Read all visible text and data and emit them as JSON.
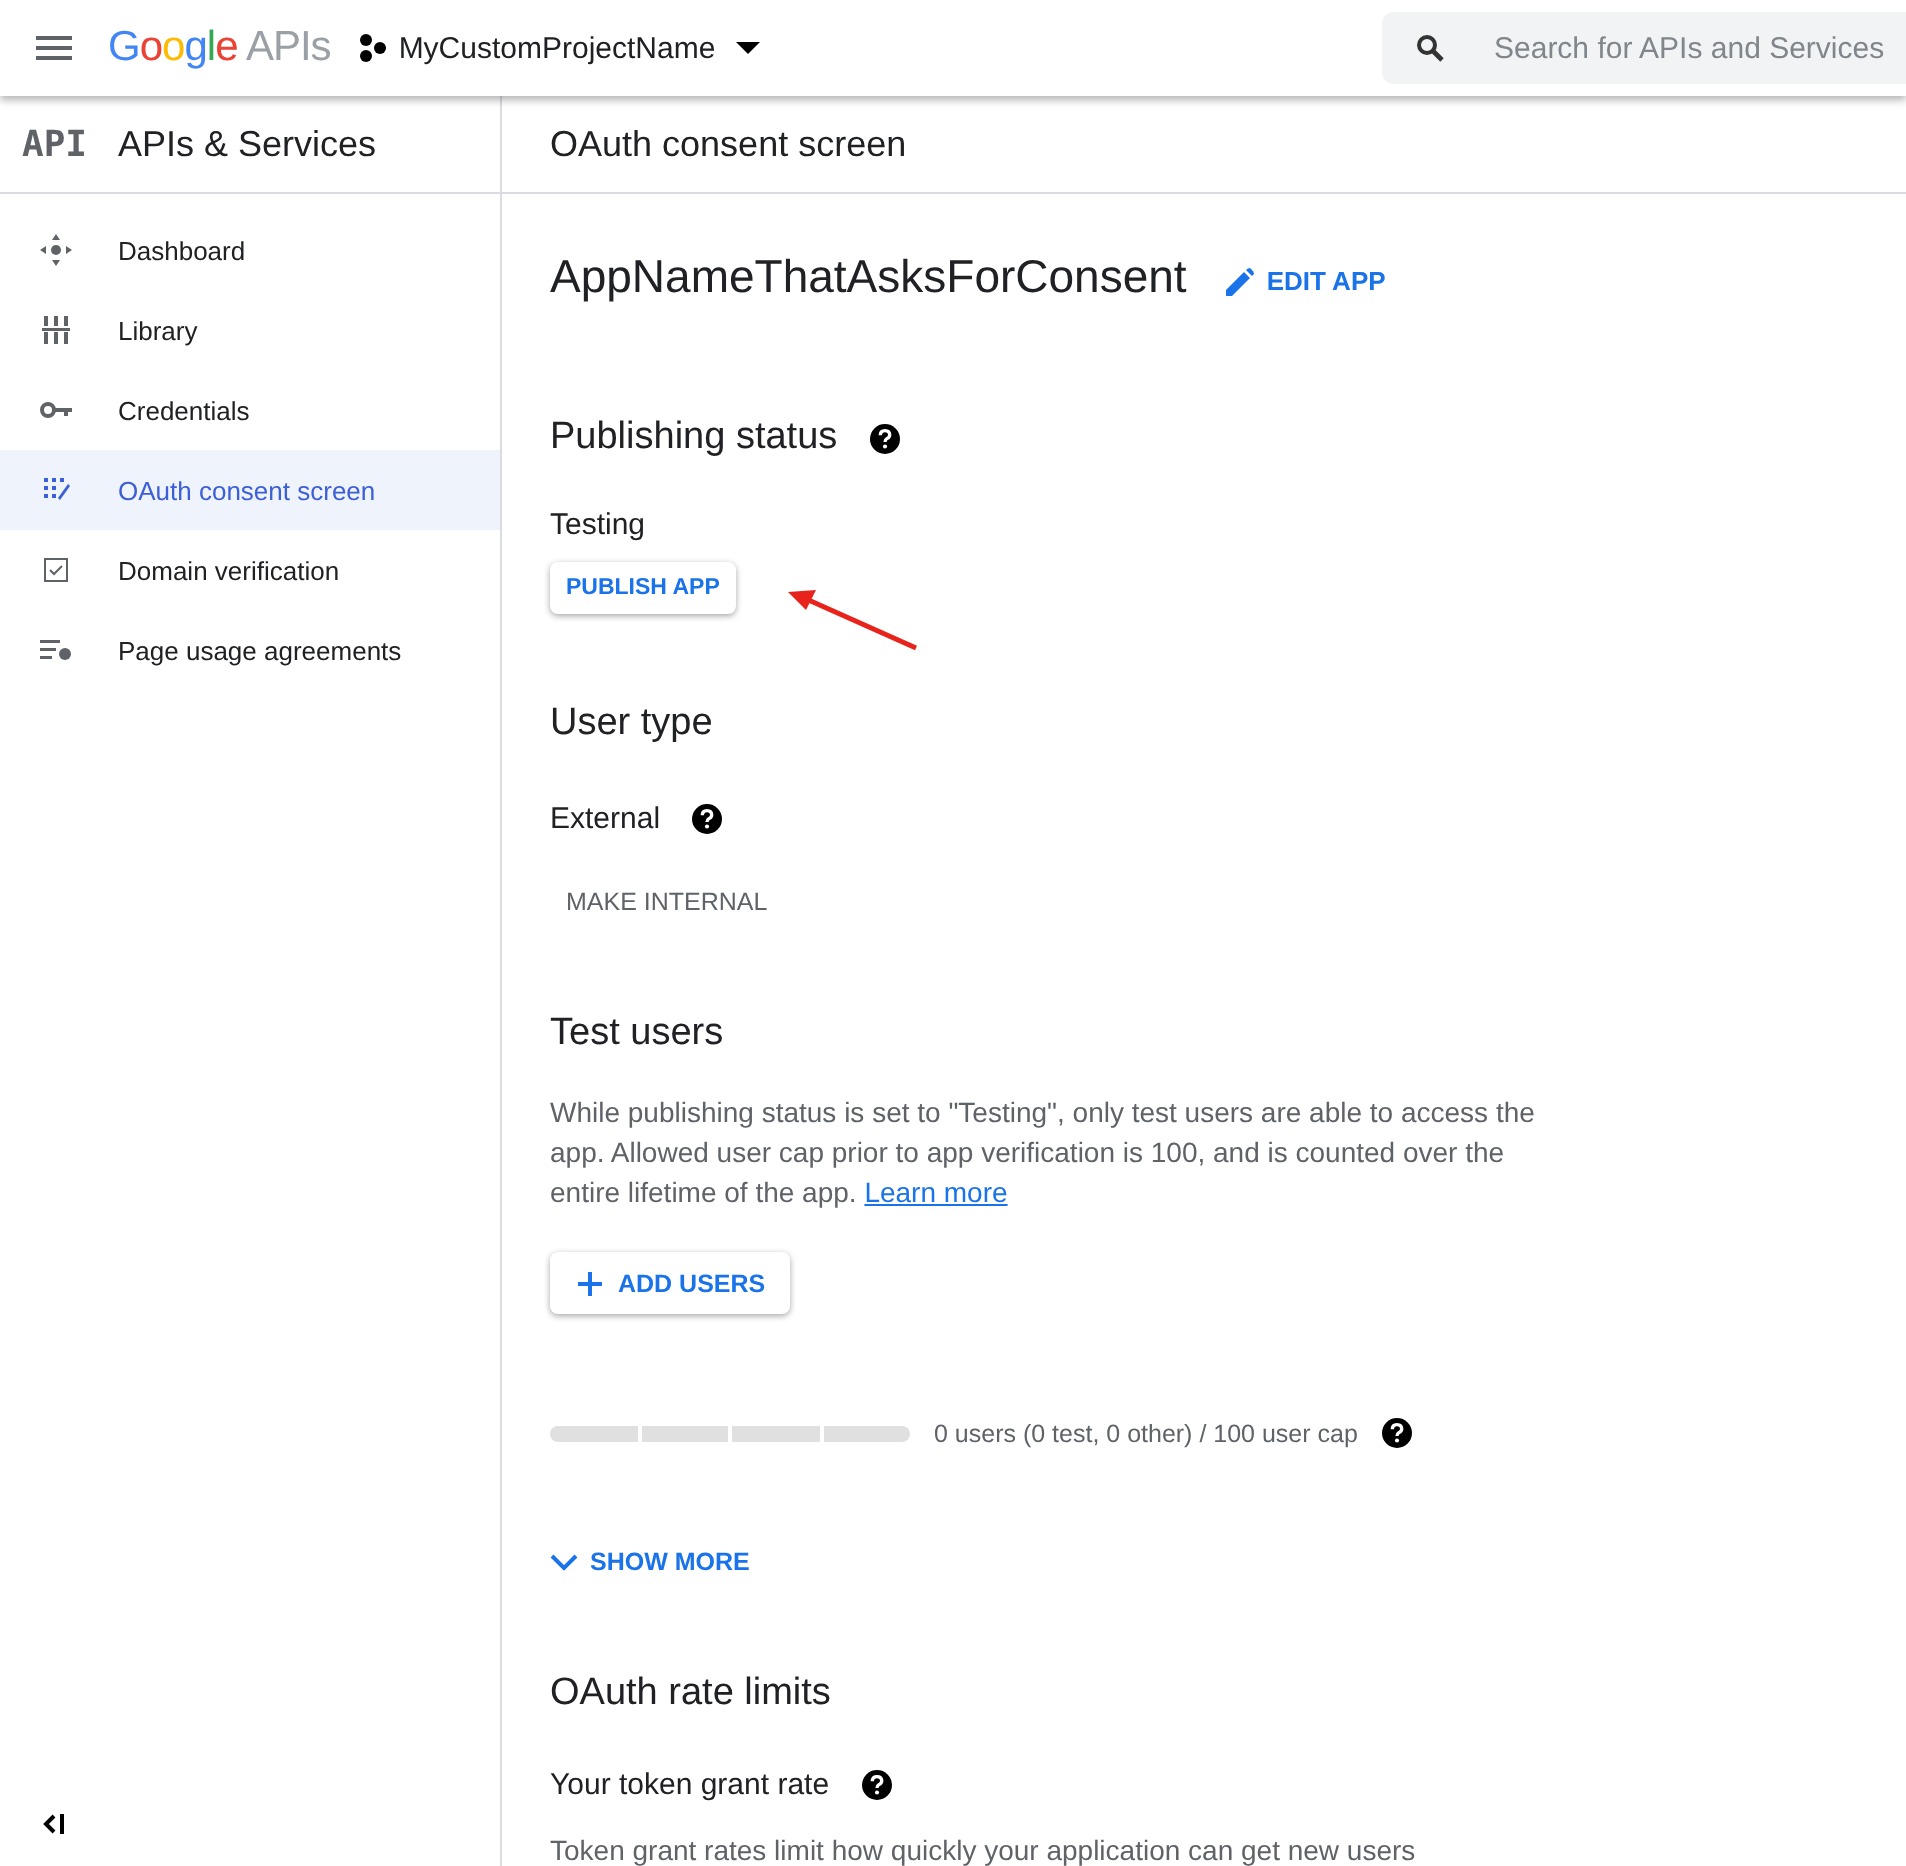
{
  "topbar": {
    "logo_letters": [
      {
        "text": "G",
        "color": "#4285f4"
      },
      {
        "text": "o",
        "color": "#ea4335"
      },
      {
        "text": "o",
        "color": "#fbbc05"
      },
      {
        "text": "g",
        "color": "#4285f4"
      },
      {
        "text": "l",
        "color": "#34a853"
      },
      {
        "text": "e",
        "color": "#ea4335"
      }
    ],
    "logo_suffix": "APIs",
    "project": "MyCustomProjectName",
    "search": {
      "placeholder": "Search for APIs and Services"
    }
  },
  "sidebar": {
    "logo": "API",
    "title": "APIs & Services",
    "items": [
      {
        "label": "Dashboard",
        "selected": false
      },
      {
        "label": "Library",
        "selected": false
      },
      {
        "label": "Credentials",
        "selected": false
      },
      {
        "label": "OAuth consent screen",
        "selected": true
      },
      {
        "label": "Domain verification",
        "selected": false
      },
      {
        "label": "Page usage agreements",
        "selected": false
      }
    ]
  },
  "main": {
    "header": "OAuth consent screen",
    "app_name": "AppNameThatAsksForConsent",
    "edit_button": "EDIT APP",
    "publishing": {
      "title": "Publishing status",
      "status": "Testing",
      "button": "PUBLISH APP"
    },
    "user_type": {
      "title": "User type",
      "value": "External",
      "button": "MAKE INTERNAL"
    },
    "test_users": {
      "title": "Test users",
      "text": "While publishing status is set to \"Testing\", only test users are able to access the app. Allowed user cap prior to app verification is 100, and is counted over the entire lifetime of the app.",
      "link": "Learn more",
      "button": "ADD USERS",
      "cap_text": "0 users (0 test, 0 other) / 100 user cap",
      "show_more": "SHOW MORE"
    },
    "rate_limits": {
      "title": "OAuth rate limits",
      "subtitle": "Your token grant rate",
      "text": "Token grant rates limit how quickly your application can get new users"
    }
  }
}
